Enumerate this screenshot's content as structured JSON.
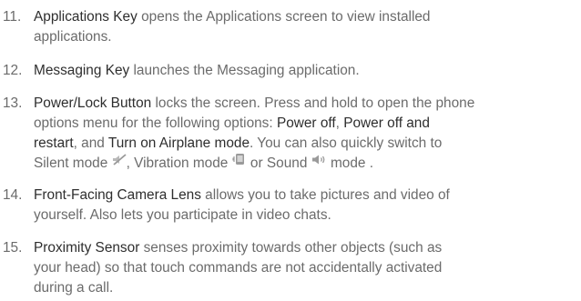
{
  "items": [
    {
      "number": "11.",
      "term": "Applications Key",
      "text1": " opens the Applications screen to view installed",
      "text2": "applications."
    },
    {
      "number": "12.",
      "term": "Messaging Key",
      "text1": " launches the Messaging application."
    },
    {
      "number": "13.",
      "term": "Power/Lock Button",
      "text1": " locks the screen. Press and hold to open the phone",
      "text2": "options menu for the following options: ",
      "opt1": "Power off",
      "sep1": ", ",
      "opt2a": "Power off and",
      "opt2b": "restart",
      "sep2": ", and ",
      "opt3": "Turn on Airplane mode",
      "text3": ". You can also quickly switch to",
      "silent": "Silent mode ",
      "vibration": ", Vibration mode ",
      "or_sound": " or Sound ",
      "mode_end": " mode .",
      "icons": [
        "mute-icon",
        "vibrate-icon",
        "speaker-icon"
      ]
    },
    {
      "number": "14.",
      "term": "Front-Facing Camera Lens",
      "text1": " allows you to take pictures and video of",
      "text2": "yourself. Also lets you participate in video chats."
    },
    {
      "number": "15.",
      "term": "Proximity Sensor",
      "text1": " senses proximity towards other objects (such as",
      "text2": "your head) so that touch commands are not accidentally activated",
      "text3": "during a call."
    }
  ],
  "colors": {
    "body_text": "#6b6b6b",
    "bold_text": "#2e2e2e"
  }
}
